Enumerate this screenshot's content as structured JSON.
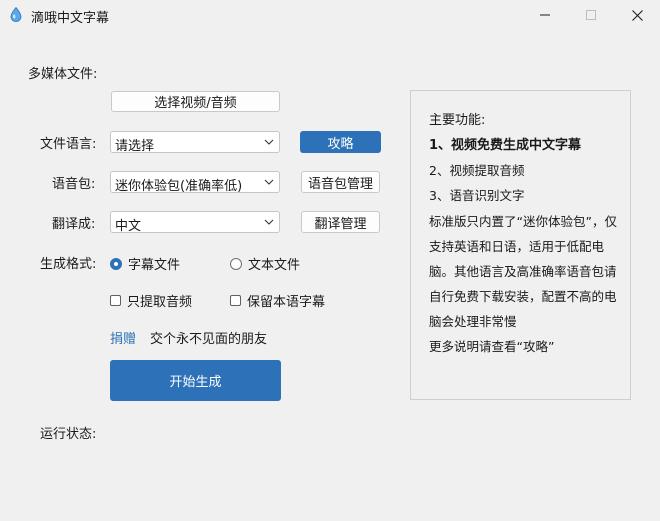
{
  "window": {
    "title": "滴哦中文字幕",
    "minimize_icon": "minimize-icon",
    "maximize_icon": "maximize-icon",
    "close_icon": "close-icon"
  },
  "colors": {
    "accent": "#2d71b8",
    "background": "#f0f0f0"
  },
  "media": {
    "label": "多媒体文件:",
    "select_button": "选择视频/音频"
  },
  "language": {
    "label": "文件语言:",
    "value": "请选择",
    "guide_button": "攻略"
  },
  "voice_pack": {
    "label": "语音包:",
    "value": "迷你体验包(准确率低)",
    "manage_button": "语音包管理"
  },
  "translate": {
    "label": "翻译成:",
    "value": "中文",
    "manage_button": "翻译管理"
  },
  "format": {
    "label": "生成格式:",
    "options": [
      {
        "label": "字幕文件",
        "selected": true
      },
      {
        "label": "文本文件",
        "selected": false
      }
    ]
  },
  "checkboxes": [
    {
      "label": "只提取音频",
      "checked": false
    },
    {
      "label": "保留本语字幕",
      "checked": false
    }
  ],
  "donate": {
    "link": "捐赠",
    "text": "交个永不见面的朋友"
  },
  "start_button": "开始生成",
  "status": {
    "label": "运行状态:"
  },
  "features": {
    "heading": "主要功能:",
    "items": [
      "1、视频免费生成中文字幕",
      "2、视频提取音频",
      "3、语音识别文字"
    ],
    "description": "标准版只内置了“迷你体验包”，仅支持英语和日语，适用于低配电脑。其他语言及高准确率语音包请自行免费下载安装，配置不高的电脑会处理非常慢",
    "more": "更多说明请查看“攻略”"
  }
}
